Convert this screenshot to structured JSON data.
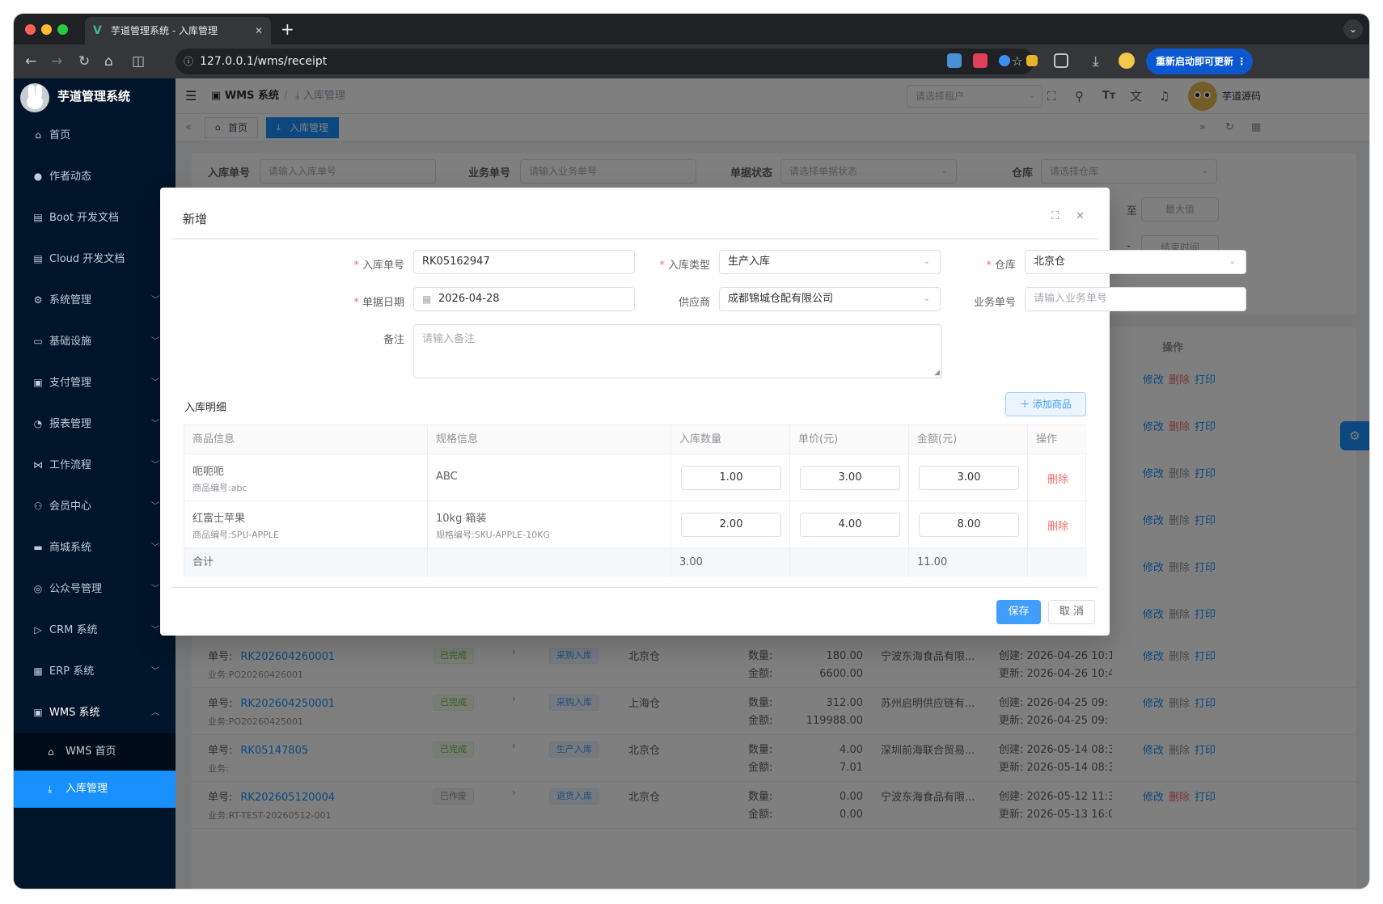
{
  "browser": {
    "tab_title": "芋道管理系统 - 入库管理",
    "url": "127.0.0.1/wms/receipt",
    "update_button": "重新启动即可更新",
    "colors": {
      "dot_red": "#ff5f57",
      "dot_yellow": "#febc2e",
      "dot_green": "#28c840"
    }
  },
  "sidebar": {
    "title": "芋道管理系统",
    "items": [
      {
        "label": "首页",
        "icon": "home-icon"
      },
      {
        "label": "作者动态",
        "icon": "user-icon"
      },
      {
        "label": "Boot 开发文档",
        "icon": "document-icon"
      },
      {
        "label": "Cloud 开发文档",
        "icon": "document-icon"
      },
      {
        "label": "系统管理",
        "icon": "gear-icon"
      },
      {
        "label": "基础设施",
        "icon": "monitor-icon"
      },
      {
        "label": "支付管理",
        "icon": "payment-icon"
      },
      {
        "label": "报表管理",
        "icon": "chart-icon"
      },
      {
        "label": "工作流程",
        "icon": "flow-icon"
      },
      {
        "label": "会员中心",
        "icon": "members-icon"
      },
      {
        "label": "商城系统",
        "icon": "shop-icon"
      },
      {
        "label": "公众号管理",
        "icon": "wechat-icon"
      },
      {
        "label": "CRM 系统",
        "icon": "crm-icon"
      },
      {
        "label": "ERP 系统",
        "icon": "erp-icon"
      },
      {
        "label": "WMS 系统",
        "icon": "warehouse-icon"
      }
    ],
    "submenu": [
      {
        "label": "WMS 首页",
        "icon": "home-icon"
      },
      {
        "label": "入库管理",
        "icon": "inbound-icon"
      }
    ]
  },
  "topnav": {
    "breadcrumb_root": "WMS 系统",
    "breadcrumb_current": "入库管理",
    "tenant_placeholder": "请选择租户",
    "user_name": "芋道源码"
  },
  "tags": {
    "home": "首页",
    "current": "入库管理"
  },
  "search": {
    "receipt_no_label": "入库单号",
    "receipt_no_placeholder": "请输入入库单号",
    "biz_no_label": "业务单号",
    "biz_no_placeholder": "请输入业务单号",
    "status_label": "单据状态",
    "status_placeholder": "请选择单据状态",
    "warehouse_label": "仓库",
    "warehouse_placeholder": "请选择仓库",
    "to_label": "至",
    "max_placeholder": "最大值",
    "dash": "-",
    "end_time_placeholder": "结束时间"
  },
  "list": {
    "ops_header": "操作",
    "ops": {
      "edit": "修改",
      "delete": "删除",
      "print": "打印"
    },
    "row_labels": {
      "no": "单号:",
      "biz": "业务:",
      "qty": "数量:",
      "amount": "金额:",
      "created": "创建:",
      "updated": "更新:"
    },
    "rows": [
      {
        "no": "RK202604260001",
        "biz": "PO20260426001",
        "status": "已完成",
        "type": "采购入库",
        "warehouse": "北京仓",
        "qty": "180.00",
        "amount": "6600.00",
        "supplier": "宁波东海食品有限...",
        "created": "2026-04-26 10:1",
        "updated": "2026-04-26 10:4"
      },
      {
        "no": "RK202604250001",
        "biz": "PO20260425001",
        "status": "已完成",
        "type": "采购入库",
        "warehouse": "上海仓",
        "qty": "312.00",
        "amount": "119988.00",
        "supplier": "苏州启明供应链有...",
        "created": "2026-04-25 09:",
        "updated": "2026-04-25 09:"
      },
      {
        "no": "RK05147805",
        "biz": "",
        "status": "已完成",
        "type": "生产入库",
        "warehouse": "北京仓",
        "qty": "4.00",
        "amount": "7.01",
        "supplier": "深圳前海联合贸易...",
        "created": "2026-05-14 08:3",
        "updated": "2026-05-14 08:3"
      },
      {
        "no": "RK202605120004",
        "biz": "RT-TEST-20260512-001",
        "status": "已作废",
        "type": "退货入库",
        "warehouse": "北京仓",
        "qty": "0.00",
        "amount": "0.00",
        "supplier": "宁波东海食品有限...",
        "created": "2026-05-12 11:3",
        "updated": "2026-05-13 16:0"
      }
    ]
  },
  "dialog": {
    "title": "新增",
    "form": {
      "receipt_no_label": "入库单号",
      "receipt_no_value": "RK05162947",
      "type_label": "入库类型",
      "type_value": "生产入库",
      "warehouse_label": "仓库",
      "warehouse_value": "北京仓",
      "date_label": "单据日期",
      "date_value": "2026-04-28",
      "supplier_label": "供应商",
      "supplier_value": "成都锦城仓配有限公司",
      "biz_no_label": "业务单号",
      "biz_no_placeholder": "请输入业务单号",
      "remark_label": "备注",
      "remark_placeholder": "请输入备注"
    },
    "detail_title": "入库明细",
    "add_button": "添加商品",
    "table": {
      "headers": [
        "商品信息",
        "规格信息",
        "入库数量",
        "单价(元)",
        "金额(元)",
        "操作"
      ],
      "rows": [
        {
          "name": "呃呃呃",
          "code": "商品编号:abc",
          "spec": "ABC",
          "spec_code": "",
          "qty": "1.00",
          "price": "3.00",
          "amount": "3.00",
          "action": "删除"
        },
        {
          "name": "红富士苹果",
          "code": "商品编号:SPU-APPLE",
          "spec": "10kg 箱装",
          "spec_code": "规格编号:SKU-APPLE-10KG",
          "qty": "2.00",
          "price": "4.00",
          "amount": "8.00",
          "action": "删除"
        }
      ],
      "footer": {
        "label": "合计",
        "qty_total": "3.00",
        "amount_total": "11.00"
      }
    },
    "save_button": "保存",
    "cancel_button": "取 消"
  }
}
